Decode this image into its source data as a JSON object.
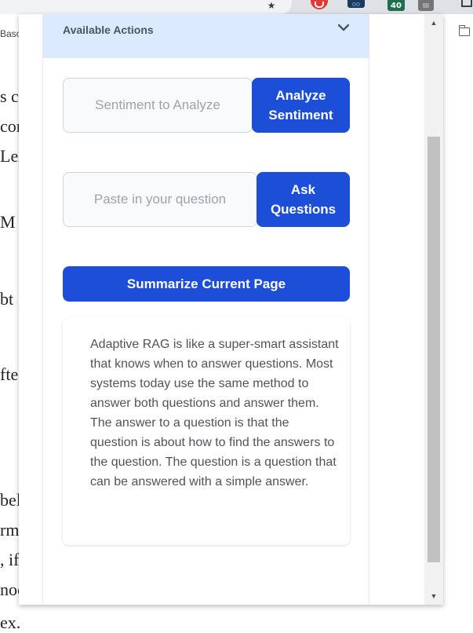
{
  "background_page": {
    "fragments_small": "Basc",
    "fragments": [
      "s c",
      "cor",
      "Lex",
      "M u",
      "bt",
      "fte",
      "bel",
      "rm",
      ", if",
      "noc",
      "ex."
    ]
  },
  "browser": {
    "extension_badge_count": "40"
  },
  "accordion": {
    "title": "Available Actions"
  },
  "sentiment": {
    "placeholder": "Sentiment to Analyze",
    "button_label": "Analyze Sentiment"
  },
  "question": {
    "placeholder": "Paste in your question",
    "button_label": "Ask Questions"
  },
  "summarize": {
    "button_label": "Summarize Current Page"
  },
  "summary_output": {
    "text": "Adaptive RAG is like a super-smart assistant that knows when to answer questions. Most systems today use the same method to answer both questions and answer them. The answer to a question is that the question is about how to find the answers to the question. The question is a question that can be answered with a simple answer."
  },
  "colors": {
    "accent": "#1d4ed8",
    "accordion_bg": "#dbeafe"
  }
}
